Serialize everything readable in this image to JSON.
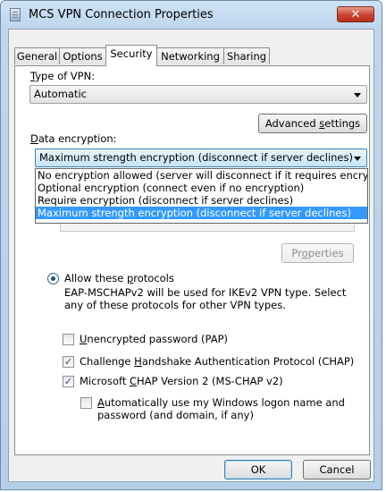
{
  "window": {
    "title": "MCS VPN Connection Properties",
    "close_glyph": "✕"
  },
  "tabs": [
    {
      "label": "General"
    },
    {
      "label": "Options"
    },
    {
      "label": "Security"
    },
    {
      "label": "Networking"
    },
    {
      "label": "Sharing"
    }
  ],
  "vpn_type": {
    "label_first": "T",
    "label_rest": "ype of VPN:",
    "value": "Automatic"
  },
  "advanced_settings": {
    "label_pre": "Advanced ",
    "label_u": "s",
    "label_post": "ettings"
  },
  "data_encryption": {
    "label_first": "D",
    "label_rest": "ata encryption:",
    "value": "Maximum strength encryption (disconnect if server declines)",
    "options": [
      "No encryption allowed (server will disconnect if it requires encryption)",
      "Optional encryption (connect even if no encryption)",
      "Require encryption (disconnect if server declines)",
      "Maximum strength encryption (disconnect if server declines)"
    ],
    "selected_index": 3
  },
  "properties_button": {
    "label_pre": "Pr",
    "label_u": "o",
    "label_post": "perties"
  },
  "allow_protocols": {
    "label_pre": "Allow these ",
    "label_u": "p",
    "label_post": "rotocols",
    "desc_line1": "EAP-MSCHAPv2 will be used for IKEv2 VPN type. Select",
    "desc_line2": "any of these protocols for other VPN types."
  },
  "protocols": [
    {
      "u": "U",
      "rest": "nencrypted password (PAP)",
      "pre": "",
      "checked": false
    },
    {
      "pre": "Challenge ",
      "u": "H",
      "rest": "andshake Authentication Protocol (CHAP)",
      "checked": true
    },
    {
      "pre": "Microsoft ",
      "u": "C",
      "rest": "HAP Version 2 (MS-CHAP v2)",
      "checked": true
    }
  ],
  "auto_logon": {
    "u": "A",
    "rest": "utomatically use my Windows logon name and",
    "line2": "password (and domain, if any)",
    "checked": false
  },
  "check_glyph": "✓",
  "buttons": {
    "ok": "OK",
    "cancel": "Cancel"
  }
}
